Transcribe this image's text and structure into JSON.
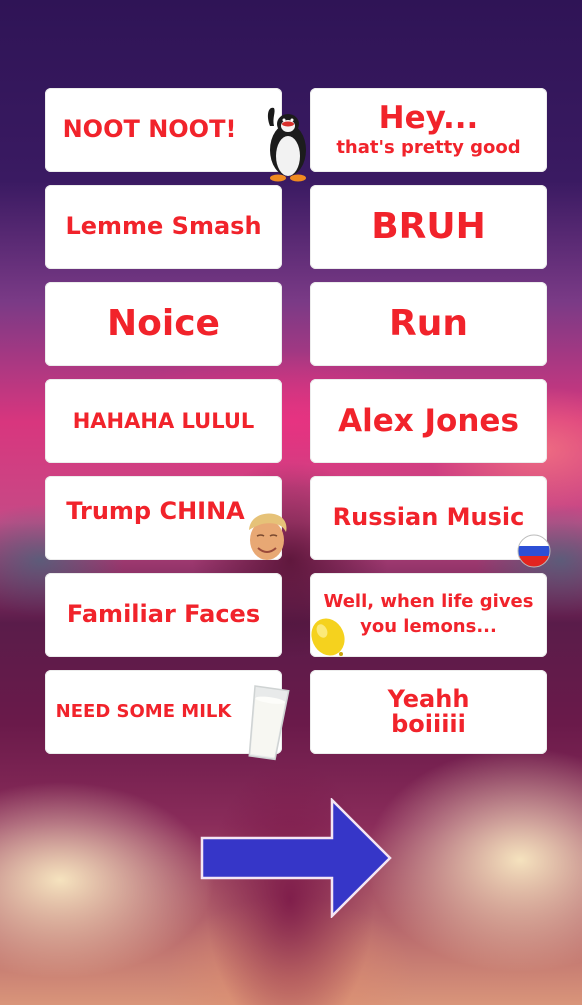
{
  "soundboard": {
    "buttons": [
      {
        "id": "noot-noot",
        "label": "NOOT NOOT!",
        "sticker": "penguin-icon"
      },
      {
        "id": "hey-thats-pretty-good",
        "label": "Hey...",
        "sublabel": "that's pretty good"
      },
      {
        "id": "lemme-smash",
        "label": "Lemme Smash"
      },
      {
        "id": "bruh",
        "label": "BRUH"
      },
      {
        "id": "noice",
        "label": "Noice"
      },
      {
        "id": "run",
        "label": "Run"
      },
      {
        "id": "hahaha-lulul",
        "label": "HAHAHA LULUL"
      },
      {
        "id": "alex-jones",
        "label": "Alex Jones"
      },
      {
        "id": "trump-china",
        "label": "Trump CHINA",
        "sticker": "trump-face-icon"
      },
      {
        "id": "russian-music",
        "label": "Russian Music",
        "sticker": "russian-flag-icon"
      },
      {
        "id": "familiar-faces",
        "label": "Familiar Faces"
      },
      {
        "id": "life-gives-lemons",
        "label": "Well, when life gives",
        "sublabel": "you lemons...",
        "sticker": "lemon-icon"
      },
      {
        "id": "need-some-milk",
        "label": "NEED SOME MILK",
        "sticker": "milk-glass-icon"
      },
      {
        "id": "yeahh-boiiiii",
        "label": "Yeahh",
        "sublabel": "boiiiii"
      }
    ]
  },
  "navigation": {
    "next_icon": "right-arrow-icon"
  },
  "colors": {
    "label": "#f1232b",
    "card": "#ffffff",
    "arrow_fill": "#3636c8",
    "arrow_stroke": "#f4e6f4"
  }
}
